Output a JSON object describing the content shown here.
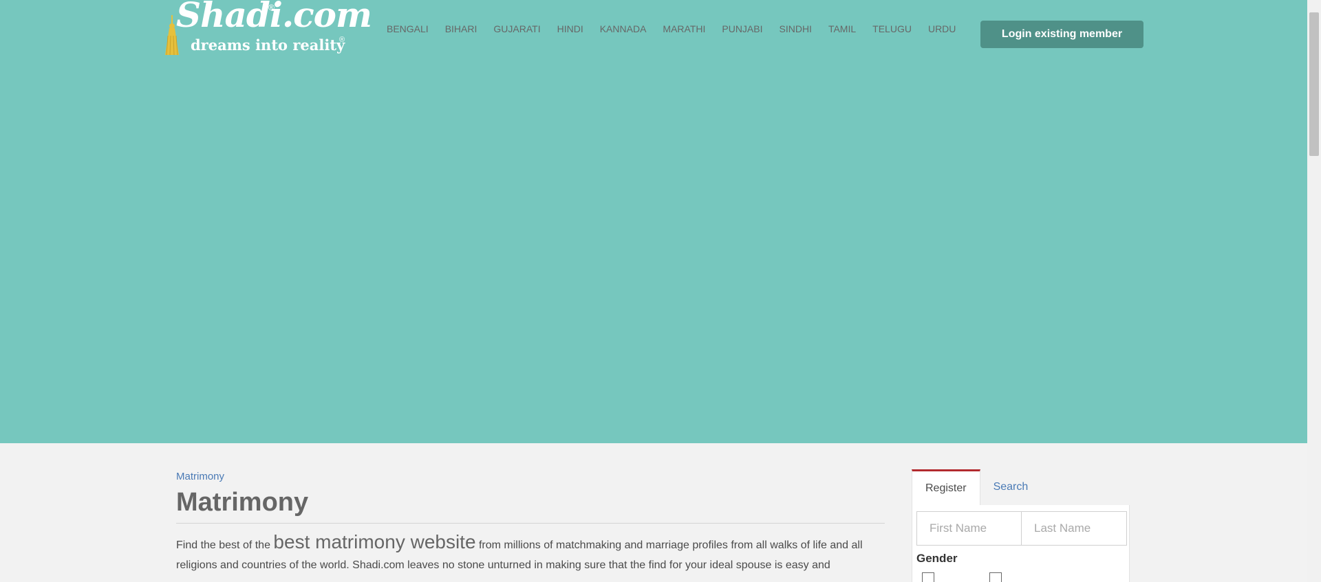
{
  "logo": {
    "title": "Shadi.com",
    "tagline": "dreams into reality",
    "registered_mark": "®"
  },
  "nav": {
    "languages": [
      "BENGALI",
      "BIHARI",
      "GUJARATI",
      "HINDI",
      "KANNADA",
      "MARATHI",
      "PUNJABI",
      "SINDHI",
      "TAMIL",
      "TELUGU",
      "URDU"
    ]
  },
  "header": {
    "login_label": "Login existing member"
  },
  "main": {
    "breadcrumb": "Matrimony",
    "title": "Matrimony",
    "intro_before": "Find the best of the ",
    "intro_highlight": "best matrimony website",
    "intro_after": " from millions of matchmaking and marriage profiles from all walks of life and all religions and countries of the world. Shadi.com leaves no stone unturned in making sure that the find for your ideal spouse is easy and"
  },
  "registration": {
    "tabs": [
      "Register",
      "Search"
    ],
    "active_tab": "Register",
    "first_name_placeholder": "First Name",
    "last_name_placeholder": "Last Name",
    "gender_label": "Gender"
  },
  "colors": {
    "hero_bg": "#76c7be",
    "login_button": "#4f9188",
    "active_tab_accent": "#b22a2e",
    "link": "#4a7ab5"
  }
}
